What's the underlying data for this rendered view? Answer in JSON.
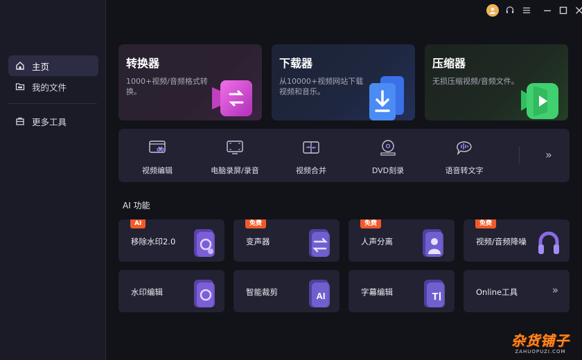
{
  "sidebar": {
    "items": [
      {
        "label": "主页",
        "icon": "home-icon"
      },
      {
        "label": "我的文件",
        "icon": "folder-icon"
      },
      {
        "label": "更多工具",
        "icon": "toolbox-icon"
      }
    ]
  },
  "topbar": {
    "icons": [
      "avatar-icon",
      "headset-icon",
      "menu-icon",
      "minimize-icon",
      "maximize-icon",
      "close-icon"
    ]
  },
  "cards": [
    {
      "title": "转换器",
      "desc": "1000+视频/音频格式转换。",
      "icon": "convert-icon"
    },
    {
      "title": "下载器",
      "desc": "从10000+视频网站下载视频和音乐。",
      "icon": "download-icon"
    },
    {
      "title": "压缩器",
      "desc": "无损压缩视频/音频文件。",
      "icon": "compress-icon"
    }
  ],
  "tools": [
    {
      "label": "视频编辑",
      "icon": "video-edit-icon"
    },
    {
      "label": "电脑录屏/录音",
      "icon": "screen-record-icon"
    },
    {
      "label": "视频合并",
      "icon": "merge-icon"
    },
    {
      "label": "DVD刻录",
      "icon": "dvd-icon"
    },
    {
      "label": "语音转文字",
      "icon": "speech-text-icon"
    }
  ],
  "ai": {
    "title": "AI 功能",
    "items": [
      {
        "label": "移除水印2.0",
        "badge": "AI"
      },
      {
        "label": "变声器",
        "badge": "免费"
      },
      {
        "label": "人声分离",
        "badge": "免费"
      },
      {
        "label": "视频/音频降噪",
        "badge": "免费"
      },
      {
        "label": "水印编辑",
        "badge": ""
      },
      {
        "label": "智能裁剪",
        "badge": ""
      },
      {
        "label": "字幕编辑",
        "badge": ""
      },
      {
        "label": "Online工具",
        "badge": ""
      }
    ]
  },
  "watermark": {
    "line1": "杂货铺子",
    "line2": "ZAHUOPUZI.COM"
  },
  "colors": {
    "accent": "#8a5cf6",
    "badge": "#f05a28",
    "background": "#121219"
  }
}
